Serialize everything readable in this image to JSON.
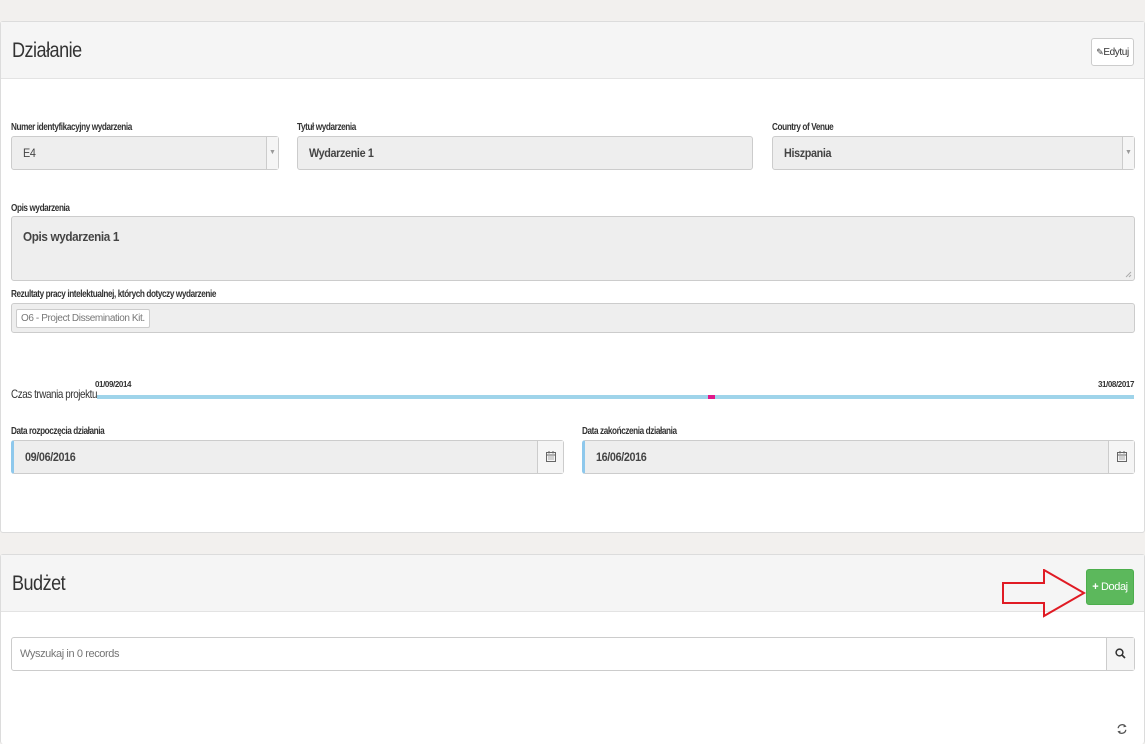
{
  "activity": {
    "title": "Działanie",
    "edit_label": "Edytuj",
    "event_id": {
      "label": "Numer identyfikacyjny wydarzenia",
      "value": "E4"
    },
    "event_title": {
      "label": "Tytuł wydarzenia",
      "value": "Wydarzenie 1"
    },
    "country": {
      "label": "Country of Venue",
      "value": "Hiszpania"
    },
    "description": {
      "label": "Opis wydarzenia",
      "value": "Opis wydarzenia 1"
    },
    "outputs": {
      "label": "Rezultaty pracy intelektualnej, których dotyczy wydarzenie",
      "tags": [
        "O6 - Project Dissemination Kit."
      ]
    },
    "timeline": {
      "label": "Czas trwania projektu",
      "start": "01/09/2014",
      "end": "31/08/2017"
    },
    "start_date": {
      "label": "Data rozpoczęcia działania",
      "value": "09/06/2016"
    },
    "end_date": {
      "label": "Data zakończenia działania",
      "value": "16/06/2016"
    }
  },
  "budget": {
    "title": "Budżet",
    "add_label": "Dodaj",
    "search_placeholder": "Wyszukaj in 0 records"
  },
  "icons": {
    "edit": "edit-icon",
    "plus": "plus-icon",
    "calendar": "calendar-icon",
    "search": "search-icon",
    "refresh": "refresh-icon",
    "annotation_arrow": "arrow-annotation-icon"
  },
  "colors": {
    "add_button": "#5cb85c",
    "timeline": "#9fd4ea",
    "timeline_marker": "#e0198a",
    "annotation": "#e01b24"
  }
}
